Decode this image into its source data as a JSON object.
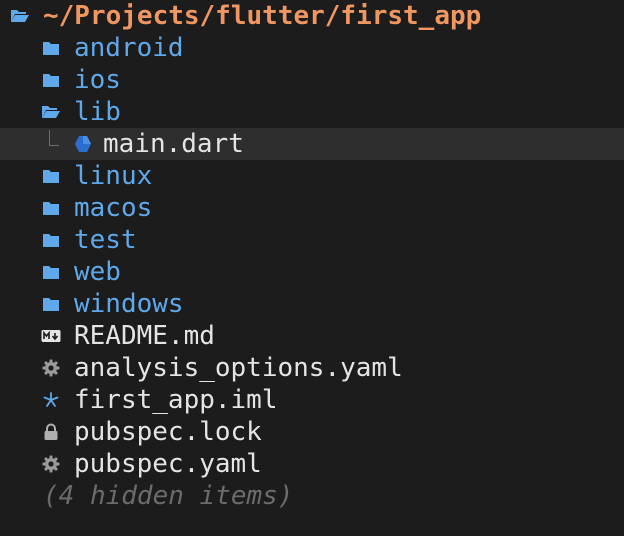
{
  "theme": {
    "background": "#1c1c1c",
    "root_color": "#f09661",
    "folder_color": "#5fa8ea",
    "file_color": "#e4e4e4",
    "muted_color": "#6b6b6b",
    "dart_color": "#2a6fd0",
    "selection_color": "#2e2e2e"
  },
  "tree": {
    "root": {
      "path": "~/Projects/flutter/first_app",
      "icon": "folder-open-icon"
    },
    "items": [
      {
        "label": "android",
        "kind": "dir",
        "icon": "folder-icon"
      },
      {
        "label": "ios",
        "kind": "dir",
        "icon": "folder-icon"
      },
      {
        "label": "lib",
        "kind": "dir",
        "icon": "folder-open-icon"
      },
      {
        "label": "main.dart",
        "kind": "file",
        "icon": "dart-icon",
        "selected": true
      },
      {
        "label": "linux",
        "kind": "dir",
        "icon": "folder-icon"
      },
      {
        "label": "macos",
        "kind": "dir",
        "icon": "folder-icon"
      },
      {
        "label": "test",
        "kind": "dir",
        "icon": "folder-icon"
      },
      {
        "label": "web",
        "kind": "dir",
        "icon": "folder-icon"
      },
      {
        "label": "windows",
        "kind": "dir",
        "icon": "folder-icon"
      },
      {
        "label": "README.md",
        "kind": "file",
        "icon": "markdown-icon"
      },
      {
        "label": "analysis_options.yaml",
        "kind": "file",
        "icon": "gear-icon"
      },
      {
        "label": "first_app.iml",
        "kind": "file",
        "icon": "star-icon"
      },
      {
        "label": "pubspec.lock",
        "kind": "file",
        "icon": "lock-icon"
      },
      {
        "label": "pubspec.yaml",
        "kind": "file",
        "icon": "gear-icon"
      }
    ],
    "hidden_note": "(4 hidden items)"
  }
}
